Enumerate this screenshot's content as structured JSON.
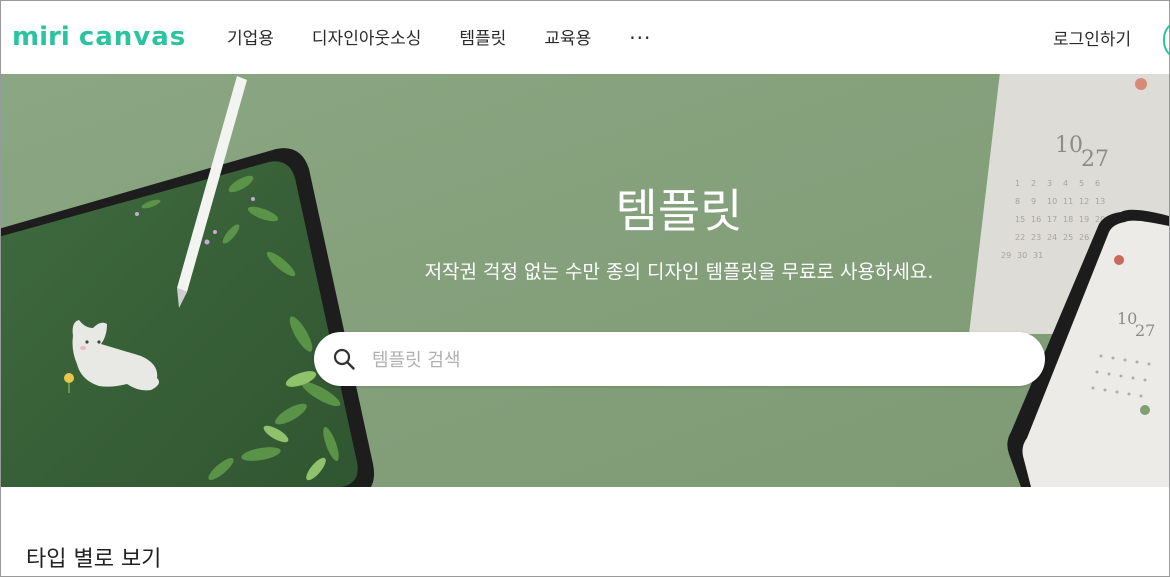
{
  "logo": {
    "miri": "miri",
    "canvas": "canvas"
  },
  "nav": {
    "items": [
      "기업용",
      "디자인아웃소싱",
      "템플릿",
      "교육용"
    ],
    "more": "···"
  },
  "header": {
    "login_label": "로그인하기"
  },
  "hero": {
    "title": "템플릿",
    "subtitle": "저작권 걱정 없는 수만 종의 디자인 템플릿을 무료로 사용하세요.",
    "calendar_date": "10/27",
    "phone_date": "10/27"
  },
  "search": {
    "placeholder": "템플릿 검색",
    "value": ""
  },
  "section": {
    "title": "타입 별로 보기"
  },
  "colors": {
    "brand": "#2bc4a0",
    "hero_bg": "#84a07a"
  },
  "icons": {
    "search": "search-icon",
    "more": "more-dots-icon"
  }
}
